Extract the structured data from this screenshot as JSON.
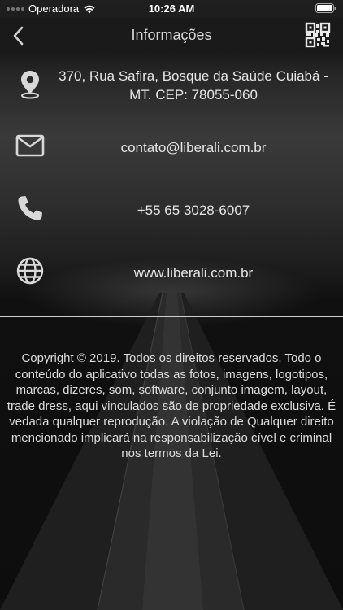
{
  "status_bar": {
    "carrier": "Operadora",
    "time": "10:26 AM"
  },
  "nav": {
    "title": "Informações"
  },
  "contacts": [
    {
      "icon": "location-pin-icon",
      "text": "370, Rua Safira, Bosque da Saúde Cuiabá - MT. CEP: 78055-060"
    },
    {
      "icon": "email-icon",
      "text": "contato@liberali.com.br"
    },
    {
      "icon": "phone-icon",
      "text": "+55 65 3028-6007"
    },
    {
      "icon": "globe-icon",
      "text": "www.liberali.com.br"
    }
  ],
  "copyright": "Copyright © 2019. Todos os direitos reservados. Todo o conteúdo do aplicativo todas as fotos, imagens, logotipos, marcas, dizeres, som, software, conjunto imagem, layout, trade dress,  aqui vinculados são de propriedade exclusiva. É vedada qualquer reprodução. A violação de Qualquer direito mencionado implicará na responsabilização cível e criminal nos termos da Lei.",
  "colors": {
    "background": "#0c0c0c",
    "nav_bar": "#1a1a1a",
    "text": "#e6e6e6",
    "icon": "#d8d8d8"
  }
}
